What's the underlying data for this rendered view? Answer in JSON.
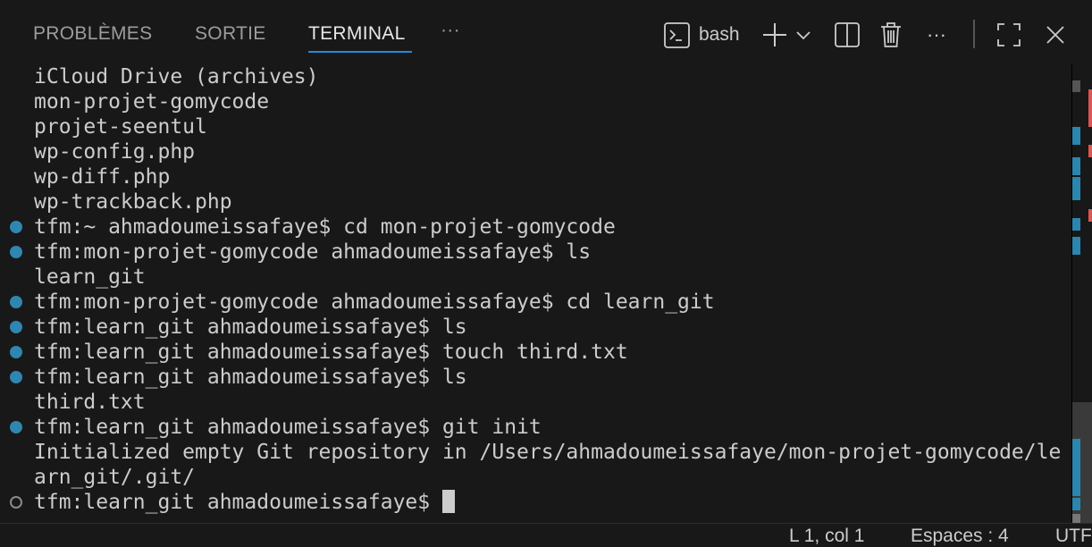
{
  "tabs": {
    "problems": "PROBLÈMES",
    "output": "SORTIE",
    "terminal": "TERMINAL",
    "more": "···"
  },
  "toolbar": {
    "shell": "bash"
  },
  "terminal": {
    "lines": [
      {
        "text": "iCloud Drive (archives)",
        "dot": "none"
      },
      {
        "text": "mon-projet-gomycode",
        "dot": "none"
      },
      {
        "text": "projet-seentul",
        "dot": "none"
      },
      {
        "text": "wp-config.php",
        "dot": "none"
      },
      {
        "text": "wp-diff.php",
        "dot": "none"
      },
      {
        "text": "wp-trackback.php",
        "dot": "none"
      },
      {
        "text": "tfm:~ ahmadoumeissafaye$ cd mon-projet-gomycode",
        "dot": "filled"
      },
      {
        "text": "tfm:mon-projet-gomycode ahmadoumeissafaye$ ls",
        "dot": "filled"
      },
      {
        "text": "learn_git",
        "dot": "none"
      },
      {
        "text": "tfm:mon-projet-gomycode ahmadoumeissafaye$ cd learn_git",
        "dot": "filled"
      },
      {
        "text": "tfm:learn_git ahmadoumeissafaye$ ls",
        "dot": "filled"
      },
      {
        "text": "tfm:learn_git ahmadoumeissafaye$ touch third.txt",
        "dot": "filled"
      },
      {
        "text": "tfm:learn_git ahmadoumeissafaye$ ls",
        "dot": "filled"
      },
      {
        "text": "third.txt",
        "dot": "none"
      },
      {
        "text": "tfm:learn_git ahmadoumeissafaye$ git init",
        "dot": "filled"
      },
      {
        "text": "Initialized empty Git repository in /Users/ahmadoumeissafaye/mon-projet-gomycode/le",
        "dot": "none"
      },
      {
        "text": "arn_git/.git/",
        "dot": "none"
      }
    ],
    "prompt": "tfm:learn_git ahmadoumeissafaye$ "
  },
  "status": {
    "position": "L 1, col 1",
    "spaces": "Espaces : 4",
    "encoding": "UTF"
  }
}
